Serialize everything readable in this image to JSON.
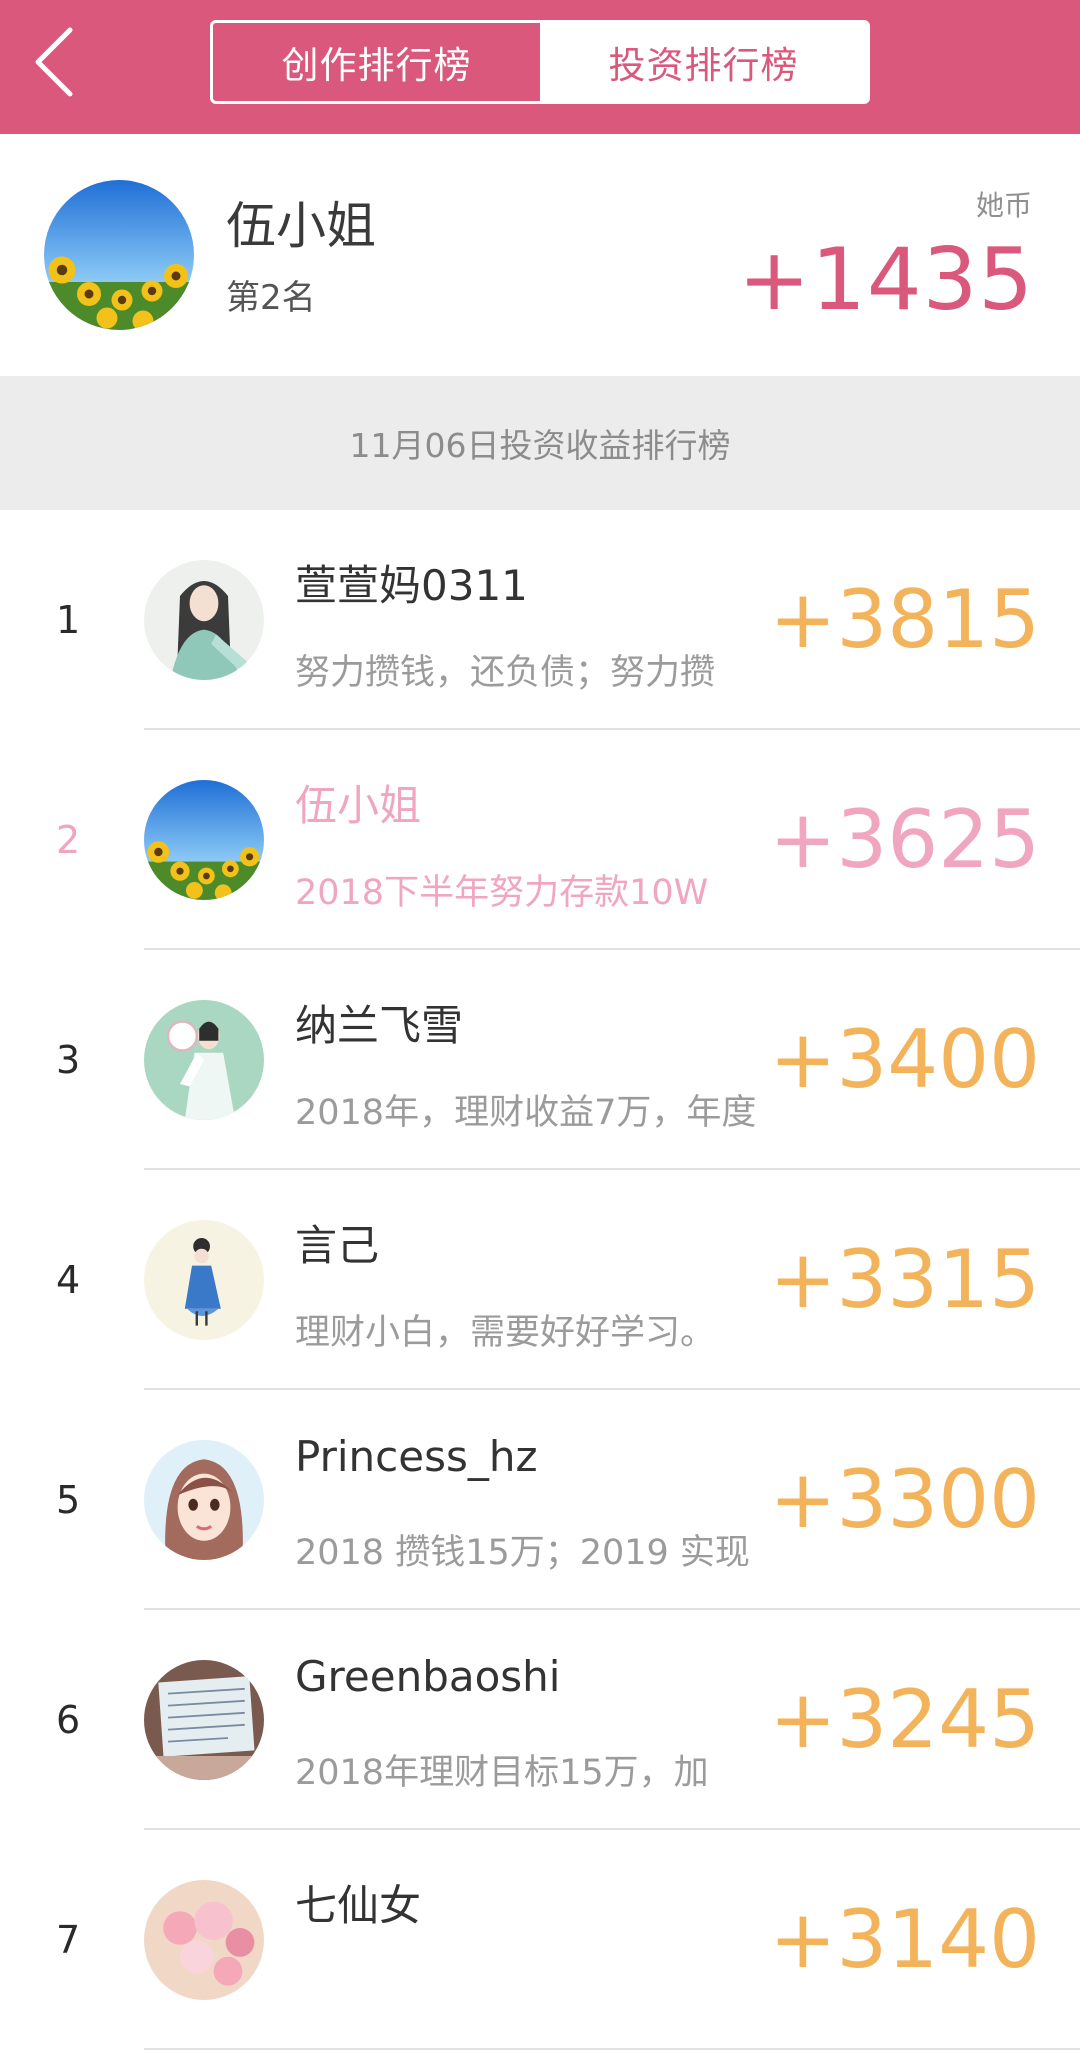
{
  "header": {
    "tabs": [
      {
        "label": "创作排行榜",
        "active": false
      },
      {
        "label": "投资排行榜",
        "active": true
      }
    ],
    "background_color": "#d9587b"
  },
  "my_rank": {
    "name": "伍小姐",
    "rank_text": "第2名",
    "coin_label": "她币",
    "score": "+1435"
  },
  "section": {
    "title": "11月06日投资收益排行榜"
  },
  "rankings": [
    {
      "rank": "1",
      "name": "萱萱妈0311",
      "desc": "努力攒钱，还负债；努力攒",
      "score": "+3815",
      "avatar": "illustration-girl-avatar"
    },
    {
      "rank": "2",
      "name": "伍小姐",
      "desc": "2018下半年努力存款10W",
      "score": "+3625",
      "avatar": "sunflower-avatar",
      "highlight": true
    },
    {
      "rank": "3",
      "name": "纳兰飞雪",
      "desc": "2018年，理财收益7万，年度",
      "score": "+3400",
      "avatar": "hanfu-girl-avatar"
    },
    {
      "rank": "4",
      "name": "言己",
      "desc": "理财小白，需要好好学习。",
      "score": "+3315",
      "avatar": "cartoon-girl-avatar"
    },
    {
      "rank": "5",
      "name": "Princess_hz",
      "desc": "2018 攒钱15万；2019 实现",
      "score": "+3300",
      "avatar": "cartoon-face-avatar"
    },
    {
      "rank": "6",
      "name": "Greenbaoshi",
      "desc": "2018年理财目标15万，加",
      "score": "+3245",
      "avatar": "notebook-avatar"
    },
    {
      "rank": "7",
      "name": "七仙女",
      "desc": "",
      "score": "+3140",
      "avatar": "flowers-avatar"
    }
  ],
  "colors": {
    "accent": "#d9587b",
    "score_orange": "#f3b35a",
    "highlight_pink": "#f0a6be"
  }
}
